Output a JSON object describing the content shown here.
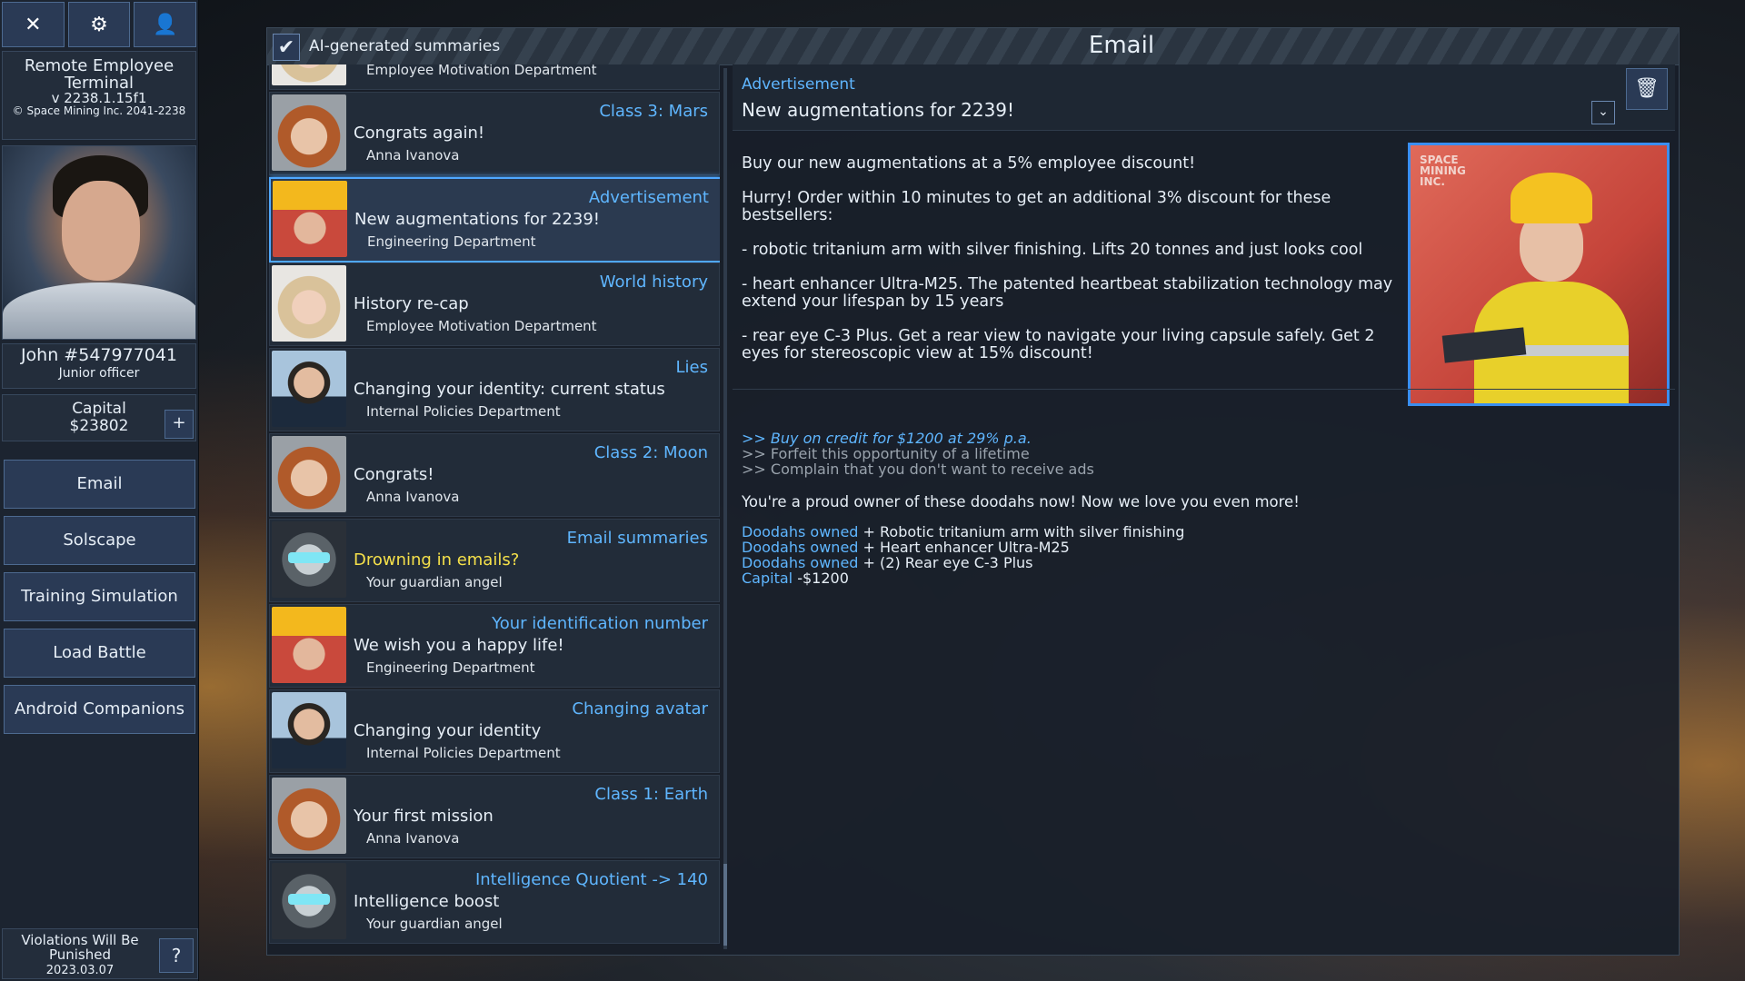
{
  "sidebar": {
    "terminal": {
      "title": "Remote Employee Terminal",
      "version": "v 2238.1.15f1",
      "copyright": "© Space Mining Inc. 2041-2238"
    },
    "user": {
      "name": "John #547977041",
      "rank": "Junior officer"
    },
    "capital": {
      "label": "Capital",
      "value": "$23802"
    },
    "nav": [
      "Email",
      "Solscape",
      "Training Simulation",
      "Load Battle",
      "Android Companions"
    ],
    "footer": {
      "text": "Violations Will Be Punished",
      "date": "2023.03.07"
    }
  },
  "header": {
    "ai_label": "AI-generated summaries",
    "title": "Email"
  },
  "emails": [
    {
      "category": "Class 3: Mars",
      "subject": "Congrats again!",
      "from": "Anna Ivanova",
      "avatar": "anna"
    },
    {
      "category": "Advertisement",
      "subject": "New augmentations for 2239!",
      "from": "Engineering Department",
      "avatar": "eng"
    },
    {
      "category": "World history",
      "subject": "History re-cap",
      "from": "Employee Motivation Department",
      "avatar": "hist"
    },
    {
      "category": "Lies",
      "subject": "Changing your identity: current status",
      "from": "Internal Policies Department",
      "avatar": "pol"
    },
    {
      "category": "Class 2: Moon",
      "subject": "Congrats!",
      "from": "Anna Ivanova",
      "avatar": "anna"
    },
    {
      "category": "Email summaries",
      "subject": "Drowning in emails?",
      "from": "Your guardian angel",
      "avatar": "guard"
    },
    {
      "category": "Your identification number",
      "subject": "We wish you a happy life!",
      "from": "Engineering Department",
      "avatar": "eng"
    },
    {
      "category": "Changing avatar",
      "subject": "Changing your identity",
      "from": "Internal Policies Department",
      "avatar": "pol"
    },
    {
      "category": "Class 1: Earth",
      "subject": "Your first mission",
      "from": "Anna Ivanova",
      "avatar": "anna"
    },
    {
      "category": "Intelligence Quotient -> 140",
      "subject": "Intelligence boost",
      "from": "Your guardian angel",
      "avatar": "guard"
    }
  ],
  "partial_top_from": "Employee Motivation Department",
  "detail": {
    "category": "Advertisement",
    "subject": "New augmentations for 2239!",
    "paragraphs": [
      "Buy our new augmentations at a 5% employee discount!",
      "Hurry! Order within 10 minutes to get an additional 3% discount for these bestsellers:",
      "- robotic tritanium arm with silver finishing. Lifts 20 tonnes and just looks cool",
      "- heart enhancer Ultra-M25. The patented heartbeat stabilization technology may extend your lifespan by 15 years",
      "- rear eye C-3 Plus. Get a rear view to navigate your living capsule safely. Get 2 eyes for stereoscopic view at 15% discount!"
    ],
    "image_brand": "SPACE\nMINING\nINC.",
    "options": [
      ">> Buy on credit for $1200 at 29% p.a.",
      ">> Forfeit this opportunity of a lifetime",
      ">> Complain that you don't want to receive ads"
    ],
    "proud": "You're a proud owner of these doodahs now! Now we love you even more!",
    "owned": [
      {
        "k": "Doodahs owned",
        "v": "+ Robotic tritanium arm with silver finishing"
      },
      {
        "k": "Doodahs owned",
        "v": "+ Heart enhancer Ultra-M25"
      },
      {
        "k": "Doodahs owned",
        "v": "+ (2) Rear eye C-3 Plus"
      },
      {
        "k": "Capital",
        "v": "-$1200"
      }
    ]
  }
}
